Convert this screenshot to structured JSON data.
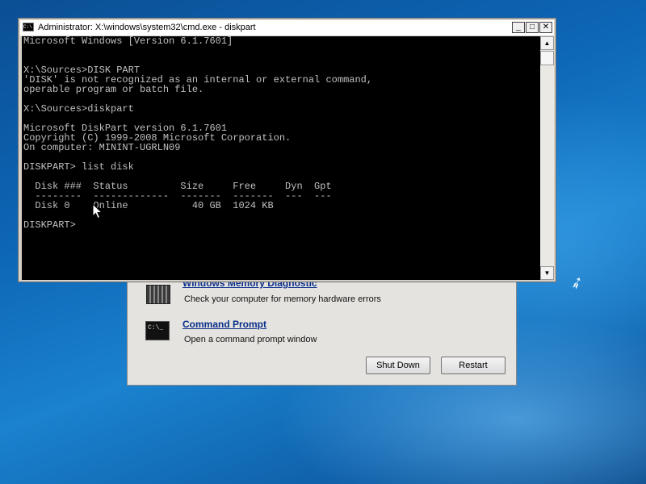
{
  "window": {
    "title": "Administrator: X:\\windows\\system32\\cmd.exe - diskpart",
    "icon": "cmd-icon",
    "buttons": {
      "minimize": "_",
      "maximize": "□",
      "close": "✕"
    }
  },
  "console": {
    "text": "Microsoft Windows [Version 6.1.7601]\n\n\nX:\\Sources>DISK PART\n'DISK' is not recognized as an internal or external command,\noperable program or batch file.\n\nX:\\Sources>diskpart\n\nMicrosoft DiskPart version 6.1.7601\nCopyright (C) 1999-2008 Microsoft Corporation.\nOn computer: MININT-UGRLN09\n\nDISKPART> list disk\n\n  Disk ###  Status         Size     Free     Dyn  Gpt\n  --------  -------------  -------  -------  ---  ---\n  Disk 0    Online           40 GB  1024 KB\n\nDISKPART>"
  },
  "scrollbar": {
    "up": "▲",
    "down": "▼"
  },
  "recovery": {
    "items": [
      {
        "title": "Windows Memory Diagnostic",
        "description": "Check your computer for memory hardware errors",
        "icon": "memory-chip-icon"
      },
      {
        "title": "Command Prompt",
        "description": "Open a command prompt window",
        "icon": "command-prompt-icon"
      }
    ],
    "buttons": {
      "shutdown": "Shut Down",
      "restart": "Restart"
    }
  },
  "desktop": {
    "accent": "#0d66b6"
  }
}
